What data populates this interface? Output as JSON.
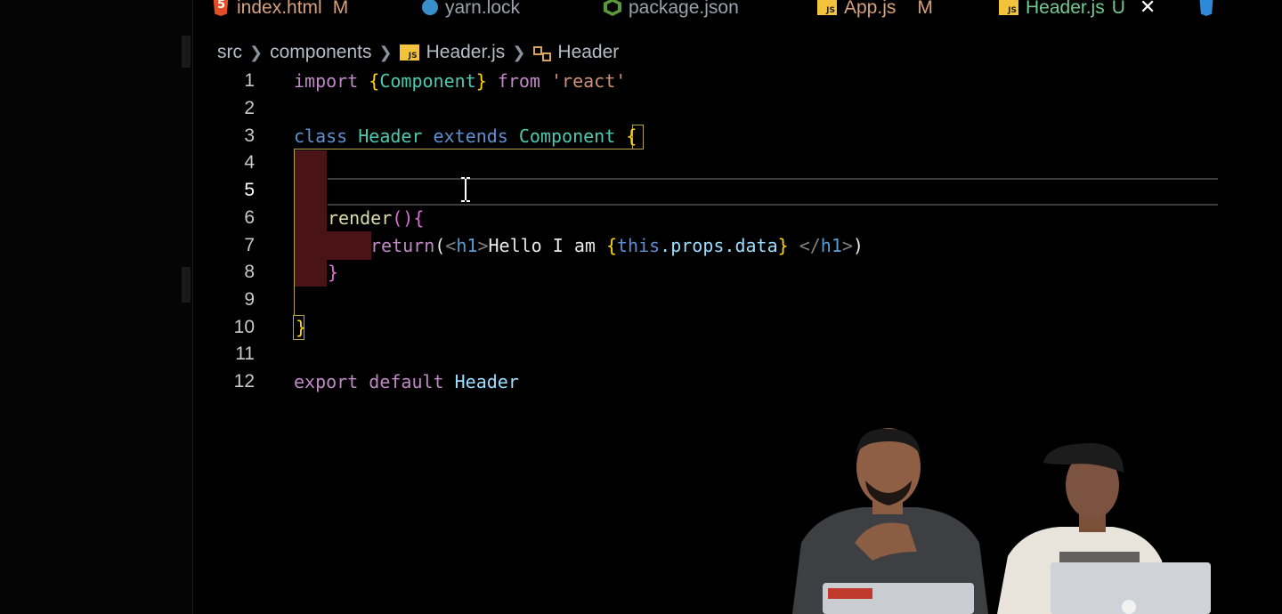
{
  "tabs": [
    {
      "label": "index.html",
      "status": "M",
      "icon": "html5-icon"
    },
    {
      "label": "yarn.lock",
      "status": "",
      "icon": "yarn-icon"
    },
    {
      "label": "package.json",
      "status": "",
      "icon": "nodejs-icon"
    },
    {
      "label": "App.js",
      "status": "M",
      "icon": "js-icon"
    },
    {
      "label": "Header.js",
      "status": "U",
      "icon": "js-icon",
      "active": true
    },
    {
      "label": "",
      "status": "",
      "icon": "css3-icon"
    }
  ],
  "breadcrumb": {
    "parts": [
      "src",
      "components",
      "Header.js",
      "Header"
    ]
  },
  "editor": {
    "line_numbers": [
      "1",
      "2",
      "3",
      "4",
      "5",
      "6",
      "7",
      "8",
      "9",
      "10",
      "11",
      "12"
    ],
    "lines": {
      "l1": {
        "a": "import ",
        "b": "{",
        "c": "Component",
        "d": "}",
        "e": " from ",
        "f": "'react'"
      },
      "l3": {
        "a": "class ",
        "b": "Header",
        "c": " extends ",
        "d": "Component",
        "e": " ",
        "f": "{"
      },
      "l6": {
        "a": "render",
        "b": "()",
        "c": "{"
      },
      "l7": {
        "a": "return",
        "b": "(",
        "c": "<",
        "d": "h1",
        "e": ">",
        "f": "Hello I am ",
        "g": "{",
        "h": "this",
        "i": ".props.data",
        "j": "}",
        "k": " </",
        "l": "h1",
        "m": ">",
        "n": ")"
      },
      "l8": {
        "a": "}"
      },
      "l10": {
        "a": "}"
      },
      "l12": {
        "a": "export ",
        "b": "default ",
        "c": "Header"
      }
    },
    "current_line": 5
  },
  "colors": {
    "background": "#000000",
    "keyword": "#5e8fd0",
    "class_name": "#4ec9b0",
    "string": "#ce9178",
    "bracket": "#ffd700",
    "error_highlight": "#4a1316"
  }
}
